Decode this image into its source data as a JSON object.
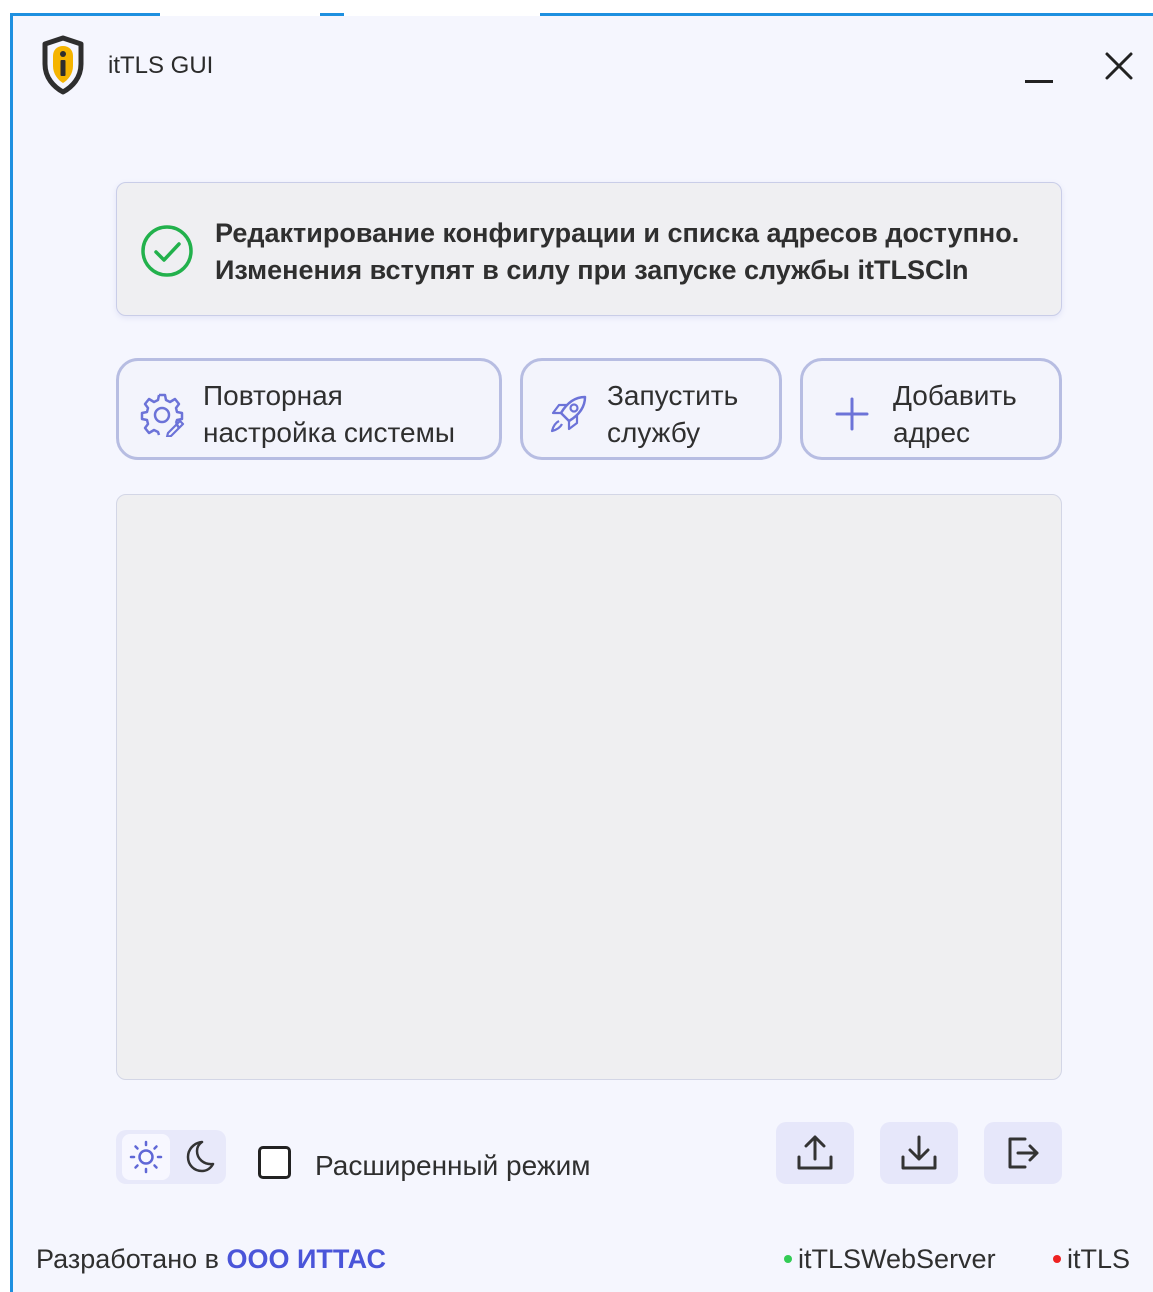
{
  "window": {
    "title": "itTLS GUI"
  },
  "notice": {
    "line1": "Редактирование конфигурации и списка адресов доступно.",
    "line2": "Изменения вступят в силу при запуске службы itTLSCln",
    "status_color": "#22b14c"
  },
  "actions": {
    "reconfigure_label": "Повторная\nнастройка системы",
    "start_service_label": "Запустить\nслужбу",
    "add_address_label": "Добавить\nадрес"
  },
  "address_list": {
    "items": []
  },
  "bottom": {
    "theme_selected": "light",
    "advanced_mode_label": "Расширенный режим",
    "advanced_mode_checked": false
  },
  "footer": {
    "developed_by": "Разработано в ",
    "company": "ООО ИТТАС",
    "services": [
      {
        "name": "itTLSWebServer",
        "status_color": "#33cc55"
      },
      {
        "name": "itTLS",
        "status_color": "#ee2222"
      }
    ]
  },
  "colors": {
    "accent": "#4a55d9",
    "window_border": "#1e90e0",
    "logo_accent": "#f5b400"
  }
}
